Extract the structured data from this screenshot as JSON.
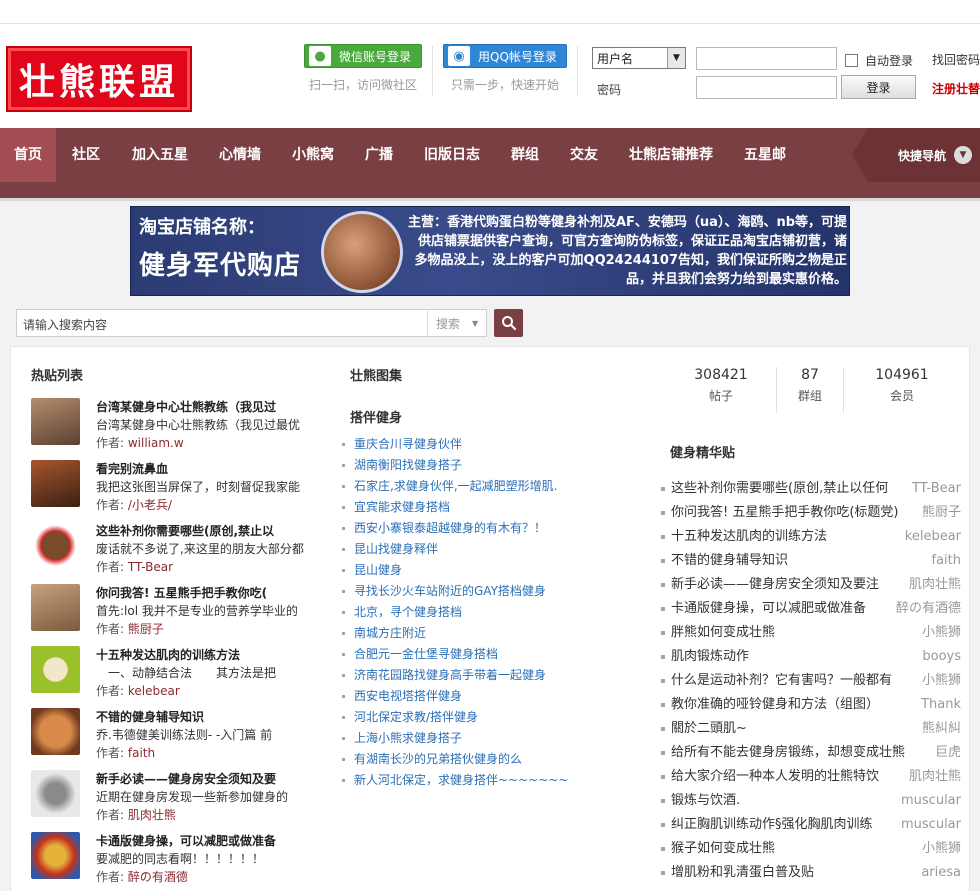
{
  "header": {
    "logo_text": "壮熊联盟",
    "wechat": {
      "label": "微信账号登录",
      "hint": "扫一扫，访问微社区"
    },
    "qq": {
      "label": "用QQ帐号登录",
      "hint": "只需一步，快速开始"
    },
    "login": {
      "username_select": "用户名",
      "password_label": "密码",
      "auto_login": "自动登录",
      "login_button": "登录",
      "find_password": "找回密码",
      "register": "注册壮替"
    }
  },
  "nav": {
    "items": [
      "首页",
      "社区",
      "加入五星",
      "心情墙",
      "小熊窝",
      "广播",
      "旧版日志",
      "群组",
      "交友",
      "壮熊店铺推荐",
      "五星邮"
    ],
    "quick_nav": "快捷导航"
  },
  "banner": {
    "title": "淘宝店铺名称：",
    "shop": "健身军代购店",
    "text": "主营：香港代购蛋白粉等健身补剂及AF、安德玛（ua）、海鸥、nb等，可提供店铺票据供客户查询，可官方查询防伪标签，保证正品淘宝店铺初营，诸多物品没上，没上的客户可加QQ24244107告知，我们保证所购之物是正品，并且我们会努力给到最实惠价格。"
  },
  "search": {
    "placeholder": "请输入搜索内容",
    "type": "搜索"
  },
  "hot": {
    "title": "热贴列表",
    "author_prefix": "作者: ",
    "items": [
      {
        "title": "台湾某健身中心壮熊教练（我见过",
        "summary": "台湾某健身中心壮熊教练（我见过最优",
        "author": "william.w"
      },
      {
        "title": "看完别流鼻血",
        "summary": "我把这张图当屏保了，时刻督促我家能",
        "author": "/小老兵/"
      },
      {
        "title": "这些补剂你需要哪些(原创,禁止以",
        "summary": "废话就不多说了,来这里的朋友大部分都",
        "author": "TT-Bear"
      },
      {
        "title": "你问我答! 五星熊手把手教你吃(",
        "summary": "首先:lol 我并不是专业的营养学毕业的",
        "author": "熊厨子"
      },
      {
        "title": "十五种发达肌肉的训练方法",
        "summary": "　一、动静结合法　　其方法是把",
        "author": "kelebear"
      },
      {
        "title": "不错的健身辅导知识",
        "summary": "乔.韦德健美训练法则- -入门篇 前",
        "author": "faith"
      },
      {
        "title": "新手必读——健身房安全须知及要",
        "summary": "近期在健身房发现一些新参加健身的",
        "author": "肌肉壮熊"
      },
      {
        "title": "卡通版健身操，可以减肥或做准备",
        "summary": "要减肥的同志看啊！！！！！！",
        "author": "醉の有酒德"
      }
    ]
  },
  "middle": {
    "gallery_title": "壮熊图集",
    "partner_title": "搭伴健身",
    "links": [
      "重庆合川寻健身伙伴",
      "湖南衡阳找健身搭子",
      "石家庄,求健身伙伴,一起减肥塑形增肌.",
      "宜宾能求健身搭档",
      "西安小寨银泰超越健身的有木有？！",
      "昆山找健身释伴",
      "昆山健身",
      "寻找长沙火车站附近的GAY搭档健身",
      "北京，寻个健身搭档",
      "南城方庄附近",
      "合肥元一金仕堡寻健身搭档",
      "济南花园路找健身高手带着一起健身",
      "西安电视塔搭伴健身",
      "河北保定求教/搭伴健身",
      "上海小熊求健身搭子",
      "有湖南长沙的兄弟搭伙健身的么",
      "新人河北保定，求健身搭伴~~~~~~~"
    ]
  },
  "stats": [
    {
      "num": "308421",
      "label": "帖子"
    },
    {
      "num": "87",
      "label": "群组"
    },
    {
      "num": "104961",
      "label": "会员"
    }
  ],
  "essence": {
    "title": "健身精华贴",
    "items": [
      {
        "title": "这些补剂你需要哪些(原创,禁止以任何",
        "author": "TT-Bear"
      },
      {
        "title": "你问我答! 五星熊手把手教你吃(标题党)",
        "author": "熊厨子"
      },
      {
        "title": "十五种发达肌肉的训练方法",
        "author": "kelebear"
      },
      {
        "title": "不错的健身辅导知识",
        "author": "faith"
      },
      {
        "title": "新手必读——健身房安全须知及要注",
        "author": "肌肉壮熊"
      },
      {
        "title": "卡通版健身操，可以减肥或做准备",
        "author": "醉の有酒德"
      },
      {
        "title": "胖熊如何变成壮熊",
        "author": "小熊狮"
      },
      {
        "title": "肌肉锻炼动作",
        "author": "booys"
      },
      {
        "title": "什么是运动补剂？它有害吗？一般都有",
        "author": "小熊狮"
      },
      {
        "title": "教你准确的哑铃健身和方法（组图）",
        "author": "Thank"
      },
      {
        "title": "關於二頭肌~",
        "author": "熊糾糾"
      },
      {
        "title": "给所有不能去健身房锻练，却想变成壮熊",
        "author": "巨虎"
      },
      {
        "title": "给大家介绍一种本人发明的壮熊特饮",
        "author": "肌肉壮熊"
      },
      {
        "title": "锻炼与饮酒.",
        "author": "muscular"
      },
      {
        "title": "纠正胸肌训练动作§强化胸肌肉训练",
        "author": "muscular"
      },
      {
        "title": "猴子如何变成壮熊",
        "author": "小熊狮"
      },
      {
        "title": "增肌粉和乳清蛋白普及贴",
        "author": "ariesa"
      }
    ]
  },
  "colors": {
    "nav": "#7a3f43",
    "nav_active": "#a14d52",
    "link": "#2b6fb6",
    "author": "#8b2a2f"
  }
}
